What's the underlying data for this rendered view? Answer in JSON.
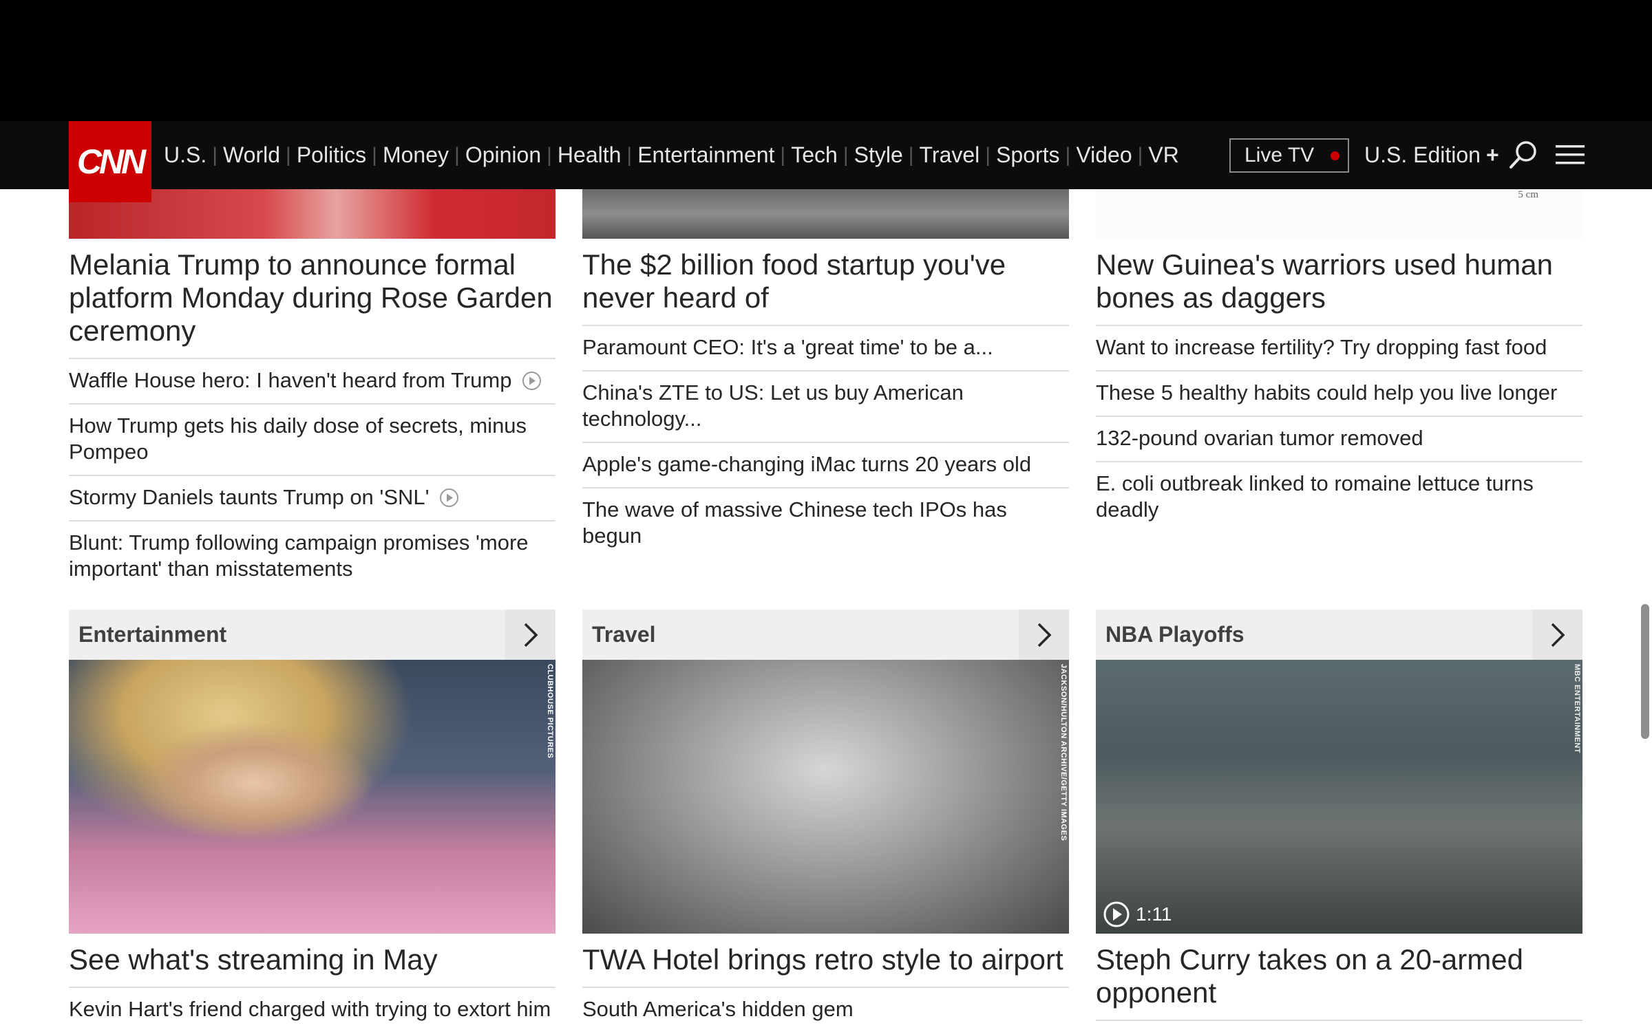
{
  "brand": {
    "logo": "CNN",
    "accent": "#cc0000"
  },
  "nav": {
    "items": [
      "U.S.",
      "World",
      "Politics",
      "Money",
      "Opinion",
      "Health",
      "Entertainment",
      "Tech",
      "Style",
      "Travel",
      "Sports",
      "Video",
      "VR"
    ],
    "live_tv": "Live TV",
    "edition": "U.S. Edition",
    "edition_plus": "+",
    "icons": [
      "search-icon",
      "menu-icon"
    ]
  },
  "columns": [
    {
      "headline": "Melania Trump to announce formal platform Monday during Rose Garden ceremony",
      "links": [
        {
          "text": "Waffle House hero: I haven't heard from Trump",
          "video": true
        },
        {
          "text": "How Trump gets his daily dose of secrets, minus Pompeo",
          "video": false
        },
        {
          "text": "Stormy Daniels taunts Trump on 'SNL'",
          "video": true
        },
        {
          "text": "Blunt: Trump following campaign promises 'more important' than misstatements",
          "video": false
        }
      ]
    },
    {
      "headline": "The $2 billion food startup you've never heard of",
      "links": [
        {
          "text": "Paramount CEO: It's a 'great time' to be a..."
        },
        {
          "text": "China's ZTE to US: Let us buy American technology..."
        },
        {
          "text": "Apple's game-changing iMac turns 20 years old"
        },
        {
          "text": "The wave of massive Chinese tech IPOs has begun"
        }
      ]
    },
    {
      "image_caption": "5 cm",
      "headline": "New Guinea's warriors used human bones as daggers",
      "links": [
        {
          "text": "Want to increase fertility? Try dropping fast food"
        },
        {
          "text": "These 5 healthy habits could help you live longer"
        },
        {
          "text": "132-pound ovarian tumor removed"
        },
        {
          "text": "E. coli outbreak linked to romaine lettuce turns deadly"
        }
      ]
    }
  ],
  "sections": [
    {
      "title": "Entertainment",
      "credit": "CLUBHOUSE PICTURES",
      "headline": "See what's streaming in May",
      "link": "Kevin Hart's friend charged with trying to extort him"
    },
    {
      "title": "Travel",
      "credit": "JACKSON/HULTON ARCHIVE/GETTY IMAGES",
      "headline": "TWA Hotel brings retro style to airport",
      "link": "South America's hidden gem"
    },
    {
      "title": "NBA Playoffs",
      "credit": "MBC ENTERTAINMENT",
      "video_duration": "1:11",
      "headline": "Steph Curry takes on a 20-armed opponent",
      "link": ""
    }
  ]
}
